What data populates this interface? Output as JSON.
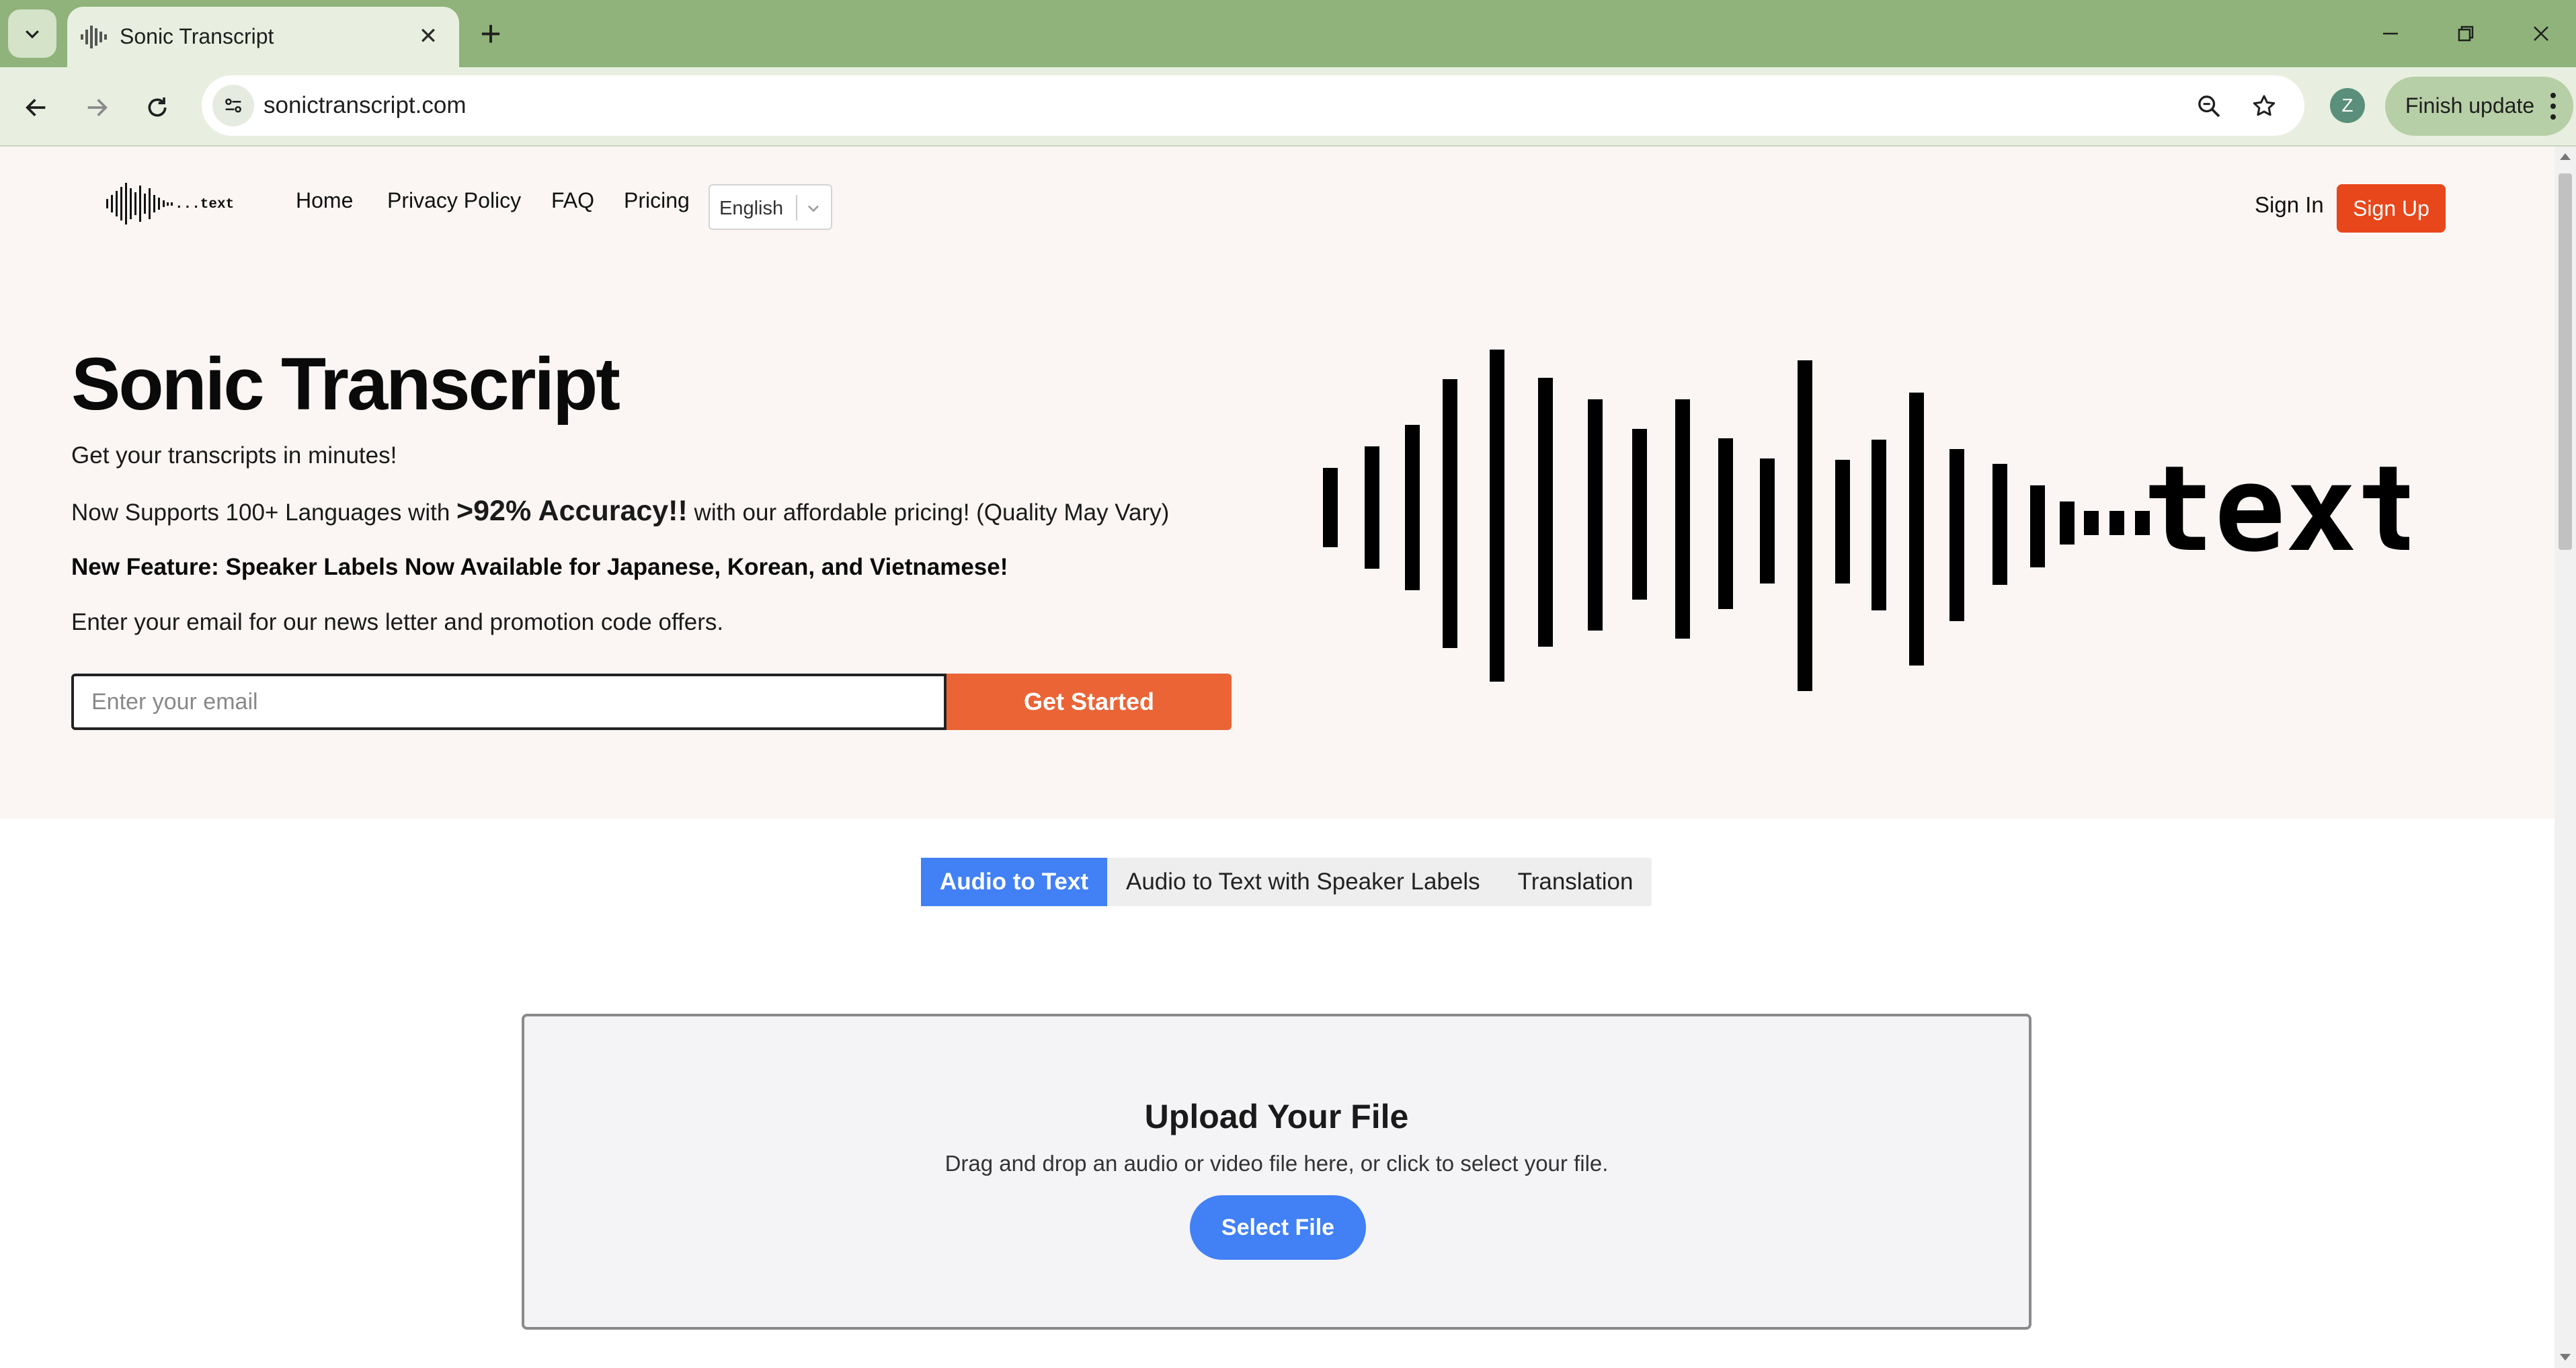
{
  "browser": {
    "tab_title": "Sonic Transcript",
    "url": "sonictranscript.com",
    "profile_initial": "Z",
    "finish_update_label": "Finish update"
  },
  "nav": {
    "links": [
      "Home",
      "Privacy Policy",
      "FAQ",
      "Pricing"
    ],
    "language": "English",
    "sign_in": "Sign In",
    "sign_up": "Sign Up"
  },
  "hero": {
    "title": "Sonic Transcript",
    "tagline": "Get your transcripts in minutes!",
    "support_prefix": "Now Supports 100+ Languages with ",
    "accuracy": ">92% Accuracy!!",
    "support_suffix": " with our affordable pricing! (Quality May Vary)",
    "feature": "New Feature: Speaker Labels Now Available for Japanese, Korean, and Vietnamese!",
    "newsletter": "Enter your email for our news letter and promotion code offers.",
    "email_placeholder": "Enter your email",
    "cta": "Get Started",
    "logo_text": "...text"
  },
  "tabs": [
    "Audio to Text",
    "Audio to Text with Speaker Labels",
    "Translation"
  ],
  "upload": {
    "title": "Upload Your File",
    "description": "Drag and drop an audio or video file here, or click to select your file.",
    "button": "Select File"
  },
  "colors": {
    "chrome": "#8fb37a",
    "accent_orange": "#e8471b",
    "cta_orange": "#ea6436",
    "tab_blue": "#4180f5"
  }
}
